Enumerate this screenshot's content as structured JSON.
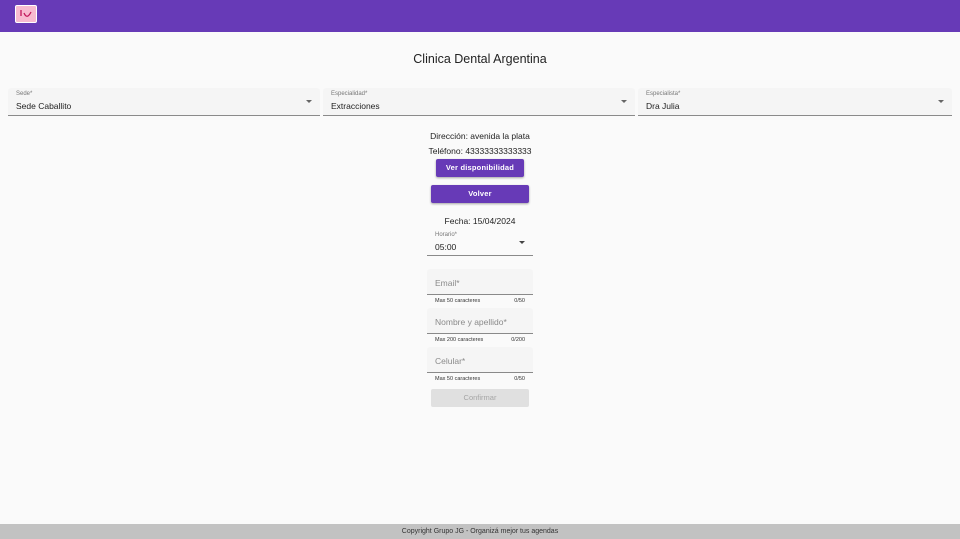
{
  "header": {
    "logo": "tooth-logo-icon",
    "title": "Clinica Dental Argentina"
  },
  "filters": {
    "sede": {
      "label": "Sede*",
      "value": "Sede Caballito"
    },
    "especialidad": {
      "label": "Especialidad*",
      "value": "Extracciones"
    },
    "especialista": {
      "label": "Especialista*",
      "value": "Dra Julia"
    }
  },
  "details": {
    "direccion": "Dirección: avenida la plata",
    "telefono": "Teléfono: 43333333333333"
  },
  "buttons": {
    "ver_disponibilidad": "Ver disponibilidad",
    "volver": "Volver",
    "confirmar": "Confirmar"
  },
  "fecha": "Fecha: 15/04/2024",
  "horario": {
    "label": "Horario*",
    "value": "05:00"
  },
  "form": {
    "email": {
      "placeholder": "Email*",
      "hint": "Max 50 caracteres",
      "counter": "0/50"
    },
    "nombre": {
      "placeholder": "Nombre y apellido*",
      "hint": "Max 200 caracteres",
      "counter": "0/200"
    },
    "celular": {
      "placeholder": "Celular*",
      "hint": "Max 50 caracteres",
      "counter": "0/50"
    }
  },
  "footer": {
    "text": "Copyright Grupo JG - Organizá mejor tus agendas"
  },
  "colors": {
    "primary": "#673ab7",
    "background": "#fafafa",
    "footer": "#c2c2c2"
  }
}
